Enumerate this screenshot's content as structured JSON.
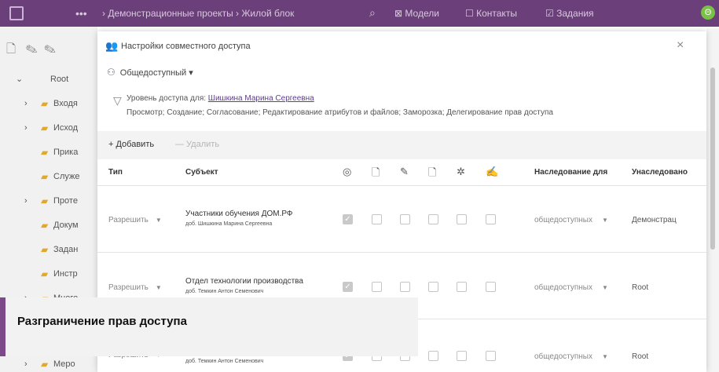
{
  "topbar": {
    "dots": "•••",
    "breadcrumb": "› Демонстрационные проекты › Жилой блок",
    "search_icon": "⌕",
    "links": [
      {
        "icon": "⊠",
        "label": "Модели"
      },
      {
        "icon": "☐",
        "label": "Контакты"
      },
      {
        "icon": "☑",
        "label": "Задания"
      }
    ],
    "user_initial": "Θ"
  },
  "sidebar": {
    "tools": [
      "🗋",
      "✎",
      "✎"
    ],
    "root_label": "Root",
    "items": [
      {
        "label": "Входя",
        "arrow": "›"
      },
      {
        "label": "Исход",
        "arrow": "›"
      },
      {
        "label": "Прика",
        "arrow": ""
      },
      {
        "label": "Служе",
        "arrow": ""
      },
      {
        "label": "Проте",
        "arrow": "›"
      },
      {
        "label": "Докум",
        "arrow": ""
      },
      {
        "label": "Задан",
        "arrow": ""
      },
      {
        "label": "Инстр",
        "arrow": ""
      },
      {
        "label": "Много",
        "arrow": "›"
      }
    ],
    "last_item": "Меро"
  },
  "dialog": {
    "title": "Настройки совместного доступа",
    "close": "×",
    "access_mode": "Общедоступный ▾",
    "level_prefix": "Уровень доступа для:",
    "level_user": "Шишкина Марина Сергеевна",
    "level_rights": "Просмотр; Создание; Согласование; Редактирование атрибутов и файлов; Заморозка; Делегирование прав доступа",
    "add_label": "+ Добавить",
    "delete_label": "— Удалить",
    "headers": {
      "type": "Тип",
      "subject": "Субъект",
      "inherit_for": "Наследование для",
      "inherited_from": "Унаследовано"
    },
    "header_icons": [
      "◎",
      "🗋",
      "✎",
      "🗋",
      "✲",
      "✍"
    ],
    "rows": [
      {
        "type": "Разрешить",
        "subject": "Участники обучения ДОМ.РФ",
        "delegate": "доб. Шишкина Марина Сергеевна",
        "checks": [
          true,
          false,
          false,
          false,
          false,
          false
        ],
        "inherit": "общедоступных",
        "from": "Демонстрац"
      },
      {
        "type": "Разрешить",
        "subject": "Отдел технологии производства",
        "delegate": "доб. Темкин Антон Семенович",
        "checks": [
          true,
          false,
          false,
          false,
          false,
          false
        ],
        "inherit": "общедоступных",
        "from": "Root"
      },
      {
        "type": "Разрешить",
        "subject": "",
        "delegate": "доб. Темкин Антон Семенович",
        "checks": [
          true,
          false,
          false,
          false,
          false,
          false
        ],
        "inherit": "общедоступных",
        "from": "Root"
      }
    ]
  },
  "caption": "Разграничение прав доступа",
  "colors": {
    "brand": "#6b3f79",
    "accent": "#7c4a8b",
    "link": "#5e3d8e"
  }
}
